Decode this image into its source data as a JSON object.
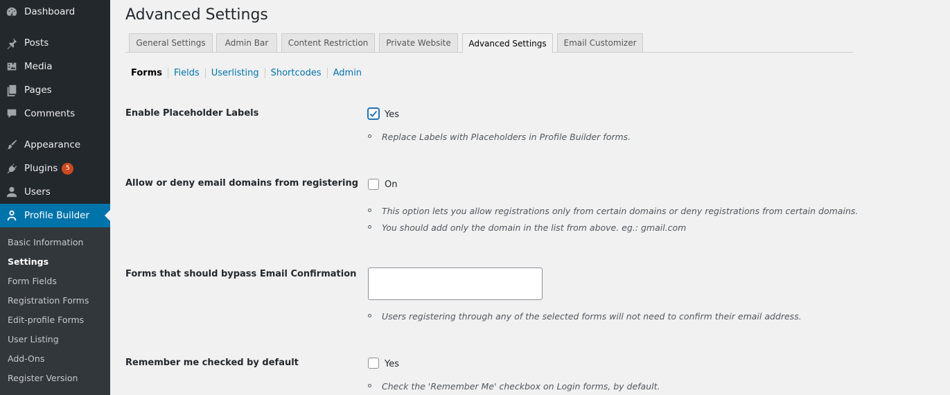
{
  "sidebar": {
    "items": [
      {
        "label": "Dashboard",
        "icon": "dashboard-icon"
      },
      {
        "label": "Posts",
        "icon": "pin-icon"
      },
      {
        "label": "Media",
        "icon": "media-icon"
      },
      {
        "label": "Pages",
        "icon": "pages-icon"
      },
      {
        "label": "Comments",
        "icon": "comments-icon"
      },
      {
        "label": "Appearance",
        "icon": "brush-icon"
      },
      {
        "label": "Plugins",
        "icon": "plugin-icon",
        "badge": "5"
      },
      {
        "label": "Users",
        "icon": "users-icon"
      },
      {
        "label": "Profile Builder",
        "icon": "user-outline-icon"
      }
    ],
    "submenu": [
      "Basic Information",
      "Settings",
      "Form Fields",
      "Registration Forms",
      "Edit-profile Forms",
      "User Listing",
      "Add-Ons",
      "Register Version"
    ]
  },
  "page": {
    "title": "Advanced Settings",
    "tabs": [
      "General Settings",
      "Admin Bar",
      "Content Restriction",
      "Private Website",
      "Advanced Settings",
      "Email Customizer"
    ],
    "subnav": [
      "Forms",
      "Fields",
      "Userlisting",
      "Shortcodes",
      "Admin"
    ]
  },
  "settings": {
    "placeholder": {
      "label": "Enable Placeholder Labels",
      "option": "Yes",
      "checked": true,
      "desc": "Replace Labels with Placeholders in Profile Builder forms."
    },
    "email_domains": {
      "label": "Allow or deny email domains from registering",
      "option": "On",
      "checked": false,
      "desc1": "This option lets you allow registrations only from certain domains or deny registrations from certain domains.",
      "desc2": "You should add only the domain in the list from above. eg.: gmail.com"
    },
    "bypass": {
      "label": "Forms that should bypass Email Confirmation",
      "value": "",
      "desc": "Users registering through any of the selected forms will not need to confirm their email address."
    },
    "remember_me": {
      "label": "Remember me checked by default",
      "option": "Yes",
      "checked": false,
      "desc": "Check the 'Remember Me' checkbox on Login forms, by default."
    }
  },
  "colors": {
    "sidebar_bg": "#23282d",
    "submenu_bg": "#32373c",
    "accent": "#0073aa",
    "badge": "#ca4a1f"
  }
}
